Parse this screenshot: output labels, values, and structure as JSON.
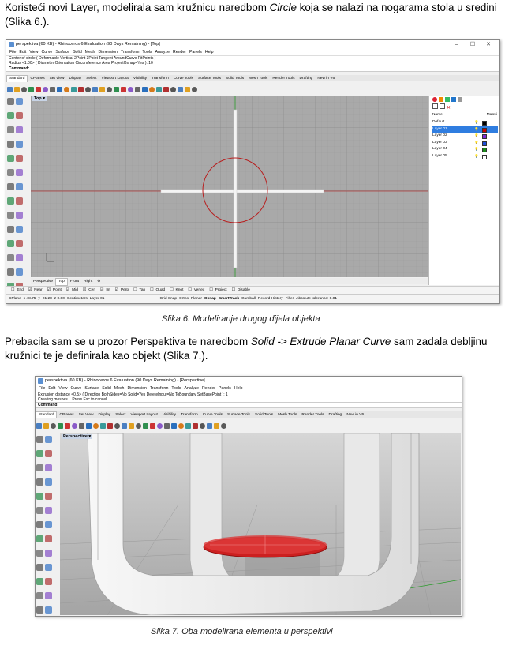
{
  "para1": {
    "pre": "Koristeći novi Layer, modelirala sam kružnicu naredbom ",
    "em": "Circle",
    "post": " koja se nalazi na nogarama stola u sredini (Slika 6.)."
  },
  "caption1": "Slika 6. Modeliranje drugog dijela objekta",
  "para2": {
    "pre": "Prebacila sam se u prozor Perspektiva te naredbom ",
    "em": "Solid -> Extrude Planar Curve",
    "post": " sam zadala debljinu kružnici te je definirala kao objekt (Slika 7.)."
  },
  "caption2": "Slika 7. Oba modelirana elementa u perspektivi",
  "fig1": {
    "title": "perspektiva (60 KB) - Rhinoceros 6 Evaluation (90 Days Remaining) - [Top]",
    "menu": [
      "File",
      "Edit",
      "View",
      "Curve",
      "Surface",
      "Solid",
      "Mesh",
      "Dimension",
      "Transform",
      "Tools",
      "Analyze",
      "Render",
      "Panels",
      "Help"
    ],
    "history": [
      "Center of circle ( Deformable  Vertical  2Point  3Point  Tangent  AroundCurve  FitPoints )",
      "Radius <1.00> ( Diameter  Orientation  Circumference  Area  ProjectOsnap=Yes ): 10"
    ],
    "command": "Command:",
    "tabs": [
      "Standard",
      "CPlanes",
      "Set View",
      "Display",
      "Select",
      "Viewport Layout",
      "Visibility",
      "Transform",
      "Curve Tools",
      "Surface Tools",
      "Solid Tools",
      "Mesh Tools",
      "Render Tools",
      "Drafting",
      "New in V6"
    ],
    "viewport_label": "Top",
    "viewport_tabs": [
      "Perspective",
      "Top",
      "Front",
      "Right"
    ],
    "osnaps": [
      "End",
      "Near",
      "Point",
      "Mid",
      "Cen",
      "Int",
      "Perp",
      "Tan",
      "Quad",
      "Knot",
      "Vertex",
      "Project",
      "Disable"
    ],
    "status": [
      "CPlane",
      "x 48.75",
      "y -21.28",
      "z 0.00",
      "Centimeters",
      "Layer 01",
      "Grid Snap",
      "Ortho",
      "Planar",
      "Osnap",
      "SmartTrack",
      "Gumball",
      "Record History",
      "Filter",
      "Absolute tolerance: 0.01"
    ],
    "layers_header": {
      "name": "Name",
      "material": "Materi"
    },
    "layers": [
      {
        "name": "Default",
        "color": "#000000"
      },
      {
        "name": "Layer 01",
        "color": "#cc0000"
      },
      {
        "name": "Layer 02",
        "color": "#7a2bd6"
      },
      {
        "name": "Layer 03",
        "color": "#1e4ed8"
      },
      {
        "name": "Layer 04",
        "color": "#1a8a1a"
      },
      {
        "name": "Layer 05",
        "color": "#ffffff"
      }
    ]
  },
  "fig2": {
    "title": "perspektiva (60 KB) - Rhinoceros 6 Evaluation (90 Days Remaining) - [Perspective]",
    "menu": [
      "File",
      "Edit",
      "View",
      "Curve",
      "Surface",
      "Solid",
      "Mesh",
      "Dimension",
      "Transform",
      "Tools",
      "Analyze",
      "Render",
      "Panels",
      "Help"
    ],
    "history": [
      "Extrusion distance <0.5> ( Direction  BothSides=No  Solid=Yes  DeleteInput=No  ToBoundary  SetBasePoint ): 1",
      "Creating meshes... Press Esc to cancel"
    ],
    "command": "Command:",
    "tabs": [
      "Standard",
      "CPlanes",
      "Set View",
      "Display",
      "Select",
      "Viewport Layout",
      "Visibility",
      "Transform",
      "Curve Tools",
      "Surface Tools",
      "Solid Tools",
      "Mesh Tools",
      "Render Tools",
      "Drafting",
      "New in V6"
    ],
    "viewport_label": "Perspective"
  }
}
